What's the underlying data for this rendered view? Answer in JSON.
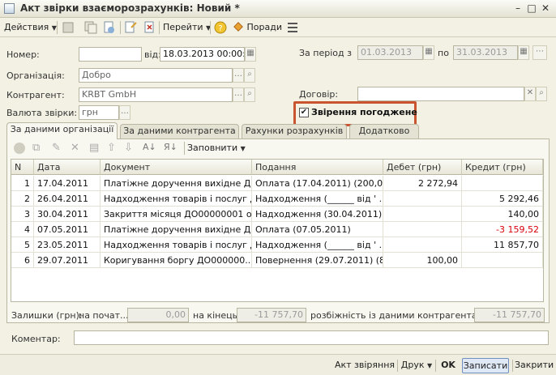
{
  "window": {
    "title": "Акт звірки взаєморозрахунків: Новий *"
  },
  "toolbar": {
    "actions_label": "Действия",
    "goto_label": "Перейти",
    "help_icon": "question-icon",
    "tips_label": "Поради"
  },
  "form": {
    "number_label": "Номер:",
    "number_value": "",
    "date_label": "від:",
    "date_value": "18.03.2013 00:00:00",
    "period_label": "За період з",
    "period_from": "01.03.2013",
    "period_to_label": "по",
    "period_to": "31.03.2013",
    "org_label": "Організація:",
    "org_value": "Добро",
    "contractor_label": "Контрагент:",
    "contractor_value": "KRBT GmbH",
    "contract_label": "Договір:",
    "contract_value": "",
    "currency_label": "Валюта звірки:",
    "currency_value": "грн",
    "agreed_label": "Звірення погоджене",
    "agreed_checked": true
  },
  "tabs": [
    "За даними організації",
    "За даними контрагента",
    "Рахунки розрахунків",
    "Додатково"
  ],
  "table_toolbar": {
    "fill_label": "Заповнити"
  },
  "table": {
    "headers": [
      "N",
      "Дата",
      "Документ",
      "Подання",
      "Дебет (грн)",
      "Кредит (грн)"
    ],
    "rows": [
      {
        "n": "1",
        "date": "17.04.2011",
        "doc": "Платіжне доручення вихідне ДО0...",
        "pres": "Оплата (17.04.2011) (200,00 ...",
        "debit": "2 272,94",
        "credit": ""
      },
      {
        "n": "2",
        "date": "26.04.2011",
        "doc": "Надходження товарів і послуг Д...",
        "pres": "Надходження (______ від ' ...",
        "debit": "",
        "credit": "5 292,46"
      },
      {
        "n": "3",
        "date": "30.04.2011",
        "doc": "Закриття місяця ДО00000001 о...",
        "pres": "Надходження (30.04.2011)",
        "debit": "",
        "credit": "140,00"
      },
      {
        "n": "4",
        "date": "07.05.2011",
        "doc": "Платіжне доручення вихідне ДО0...",
        "pres": "Оплата (07.05.2011)",
        "debit": "",
        "credit": "-3 159,52"
      },
      {
        "n": "5",
        "date": "23.05.2011",
        "doc": "Надходження товарів і послуг Д...",
        "pres": "Надходження (______ від ' ...",
        "debit": "",
        "credit": "11 857,70"
      },
      {
        "n": "6",
        "date": "29.07.2011",
        "doc": "Коригування боргу ДО000000...",
        "pres": "Повернення (29.07.2011) (8,...",
        "debit": "100,00",
        "credit": ""
      }
    ]
  },
  "balances": {
    "label": "Залишки (грн):",
    "start_label": "на почат...",
    "start_value": "0,00",
    "end_label": "на кінець:",
    "end_value": "-11 757,70",
    "diff_label": "розбіжність із даними контрагента:",
    "diff_value": "-11 757,70"
  },
  "comment": {
    "label": "Коментар:",
    "value": ""
  },
  "bottom": {
    "act_label": "Акт звіряння",
    "print_label": "Друк",
    "ok_label": "OK",
    "save_label": "Записати",
    "close_label": "Закрити"
  },
  "colors": {
    "highlight": "#c9542f",
    "negative": "#d8000c"
  }
}
